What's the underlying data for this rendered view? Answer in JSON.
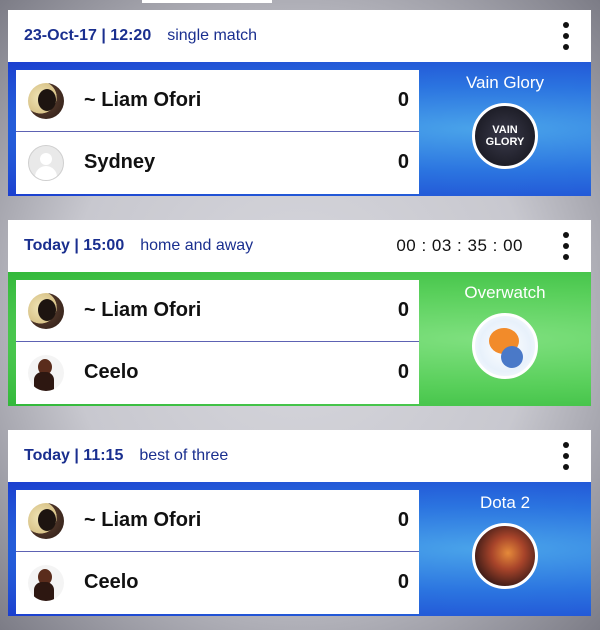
{
  "matches": [
    {
      "date": "23-Oct-17 | 12:20",
      "mode": "single match",
      "timer": "",
      "players": [
        {
          "name": "~ Liam Ofori",
          "score": "0"
        },
        {
          "name": "Sydney",
          "score": "0"
        }
      ],
      "game": {
        "name": "Vain Glory",
        "logo_text_1": "VAIN",
        "logo_text_2": "GLORY"
      },
      "accent": "#1b3fcf"
    },
    {
      "date": "Today | 15:00",
      "mode": "home and away",
      "timer": "00 : 03 : 35 : 00",
      "players": [
        {
          "name": "~ Liam Ofori",
          "score": "0"
        },
        {
          "name": "Ceelo",
          "score": "0"
        }
      ],
      "game": {
        "name": "Overwatch"
      },
      "accent": "#32b83a"
    },
    {
      "date": "Today | 11:15",
      "mode": "best of three",
      "timer": "",
      "players": [
        {
          "name": "~ Liam Ofori",
          "score": "0"
        },
        {
          "name": "Ceelo",
          "score": "0"
        }
      ],
      "game": {
        "name": "Dota 2"
      },
      "accent": "#1b3fcf"
    }
  ],
  "icons": {
    "menu": "more-vert-icon",
    "default_avatar": "user-placeholder-icon"
  }
}
